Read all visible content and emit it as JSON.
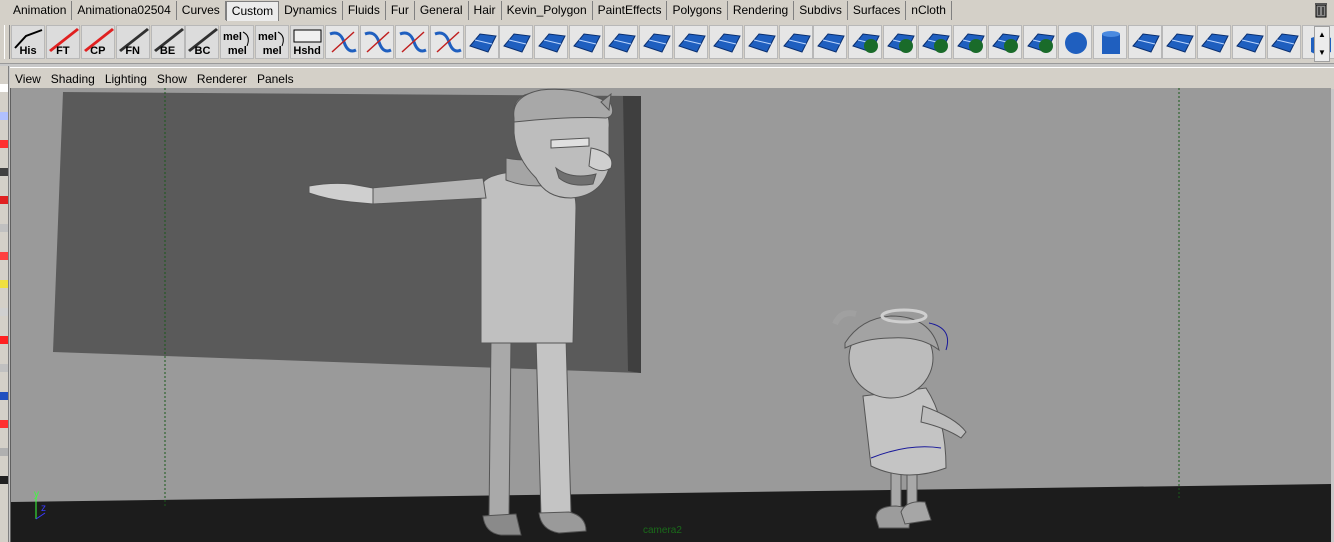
{
  "shelf_tabs": [
    {
      "label": "Animation",
      "active": false
    },
    {
      "label": "Animationa02504",
      "active": false
    },
    {
      "label": "Curves",
      "active": false
    },
    {
      "label": "Custom",
      "active": true
    },
    {
      "label": "Dynamics",
      "active": false
    },
    {
      "label": "Fluids",
      "active": false
    },
    {
      "label": "Fur",
      "active": false
    },
    {
      "label": "General",
      "active": false
    },
    {
      "label": "Hair",
      "active": false
    },
    {
      "label": "Kevin_Polygon",
      "active": false
    },
    {
      "label": "PaintEffects",
      "active": false
    },
    {
      "label": "Polygons",
      "active": false
    },
    {
      "label": "Rendering",
      "active": false
    },
    {
      "label": "Subdivs",
      "active": false
    },
    {
      "label": "Surfaces",
      "active": false
    },
    {
      "label": "nCloth",
      "active": false
    }
  ],
  "shelf_buttons": [
    {
      "label": "His",
      "icon": "his-icon"
    },
    {
      "label": "FT",
      "icon": "ft-arrow-icon"
    },
    {
      "label": "CP",
      "icon": "cp-arrow-icon"
    },
    {
      "label": "FN",
      "icon": "fn-icon"
    },
    {
      "label": "BE",
      "icon": "be-icon"
    },
    {
      "label": "BC",
      "icon": "bc-icon"
    },
    {
      "label": "mel",
      "icon": "mel-script-icon"
    },
    {
      "label": "mel",
      "icon": "mel-script-icon"
    },
    {
      "label": "Hshd",
      "icon": "hshd-icon"
    },
    {
      "label": "",
      "icon": "curve-tool-icon"
    },
    {
      "label": "",
      "icon": "curve-edit-icon"
    },
    {
      "label": "",
      "icon": "cv-curve-icon"
    },
    {
      "label": "",
      "icon": "ep-curve-icon"
    },
    {
      "label": "",
      "icon": "loft-icon"
    },
    {
      "label": "",
      "icon": "extrude-icon"
    },
    {
      "label": "",
      "icon": "planar-icon"
    },
    {
      "label": "",
      "icon": "nurbs-plane-icon"
    },
    {
      "label": "",
      "icon": "bevel-icon"
    },
    {
      "label": "",
      "icon": "trim-icon"
    },
    {
      "label": "",
      "icon": "nurbs-patch-icon"
    },
    {
      "label": "",
      "icon": "stitch-icon"
    },
    {
      "label": "",
      "icon": "rebuild-icon"
    },
    {
      "label": "",
      "icon": "grid-surface-icon"
    },
    {
      "label": "",
      "icon": "lattice-icon"
    },
    {
      "label": "",
      "icon": "sphere-select-icon"
    },
    {
      "label": "",
      "icon": "sphere-move-icon"
    },
    {
      "label": "",
      "icon": "boolean-icon"
    },
    {
      "label": "",
      "icon": "sphere-sculpt-icon"
    },
    {
      "label": "",
      "icon": "split-polygon-icon"
    },
    {
      "label": "",
      "icon": "merge-polygon-icon"
    },
    {
      "label": "",
      "icon": "sphere-icon"
    },
    {
      "label": "",
      "icon": "cylinder-icon"
    },
    {
      "label": "",
      "icon": "plane-icon"
    },
    {
      "label": "",
      "icon": "soccer-ball-icon"
    },
    {
      "label": "",
      "icon": "prism-icon"
    },
    {
      "label": "",
      "icon": "torus-poly-icon"
    },
    {
      "label": "",
      "icon": "pipe-icon"
    },
    {
      "label": "",
      "icon": "cube-icon"
    },
    {
      "label": "",
      "icon": "circle-icon"
    }
  ],
  "panel_menu": [
    "View",
    "Shading",
    "Lighting",
    "Show",
    "Renderer",
    "Panels"
  ],
  "camera_label": "camera2",
  "axis_labels": {
    "y": "y",
    "z": "z"
  },
  "colors": {
    "ui_bg": "#d4d0c8",
    "viewport_bg": "#9a9a9a",
    "floor": "#1c1c1c",
    "camera_label": "#1a6b1a",
    "icon_blue": "#1f5fbf"
  }
}
